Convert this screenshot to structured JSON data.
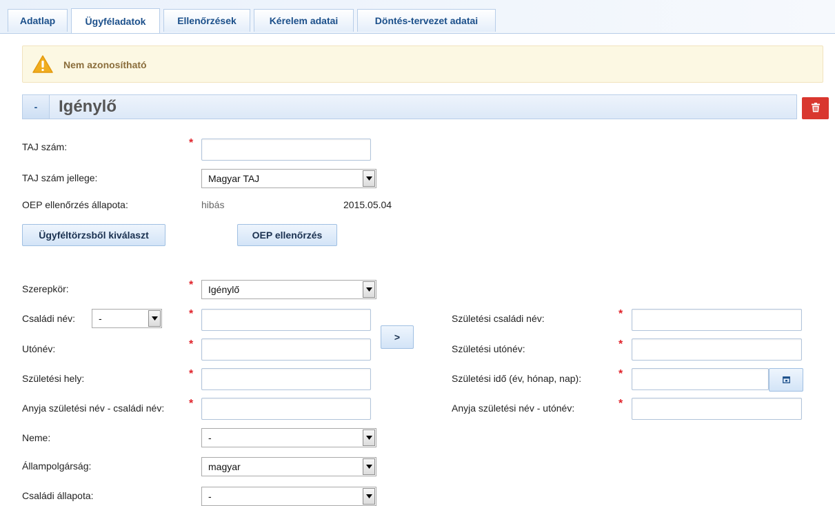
{
  "tabs": [
    {
      "label": "Adatlap"
    },
    {
      "label": "Ügyféladatok"
    },
    {
      "label": "Ellenőrzések"
    },
    {
      "label": "Kérelem adatai"
    },
    {
      "label": "Döntés-tervezet adatai"
    }
  ],
  "alert": {
    "text": "Nem azonosítható",
    "icon": "warning-icon",
    "color": "#8a6d3b"
  },
  "section": {
    "collapse_label": "-",
    "title": "Igénylő"
  },
  "form": {
    "taj_label": "TAJ szám:",
    "taj_value": "",
    "taj_type_label": "TAJ szám jellege:",
    "taj_type_value": "Magyar TAJ",
    "oep_status_label": "OEP ellenőrzés állapota:",
    "oep_status_value": "hibás",
    "oep_status_date": "2015.05.04",
    "select_client_button": "Ügyféltörzsből kiválaszt",
    "oep_check_button": "OEP ellenőrzés",
    "role_label": "Szerepkör:",
    "role_value": "Igénylő",
    "family_name_label": "Családi név:",
    "family_name_prefix": "-",
    "given_name_label": "Utónév:",
    "birth_place_label": "Születési hely:",
    "mother_family_label": "Anyja születési név - családi név:",
    "gender_label": "Neme:",
    "gender_value": "-",
    "citizenship_label": "Állampolgárság:",
    "citizenship_value": "magyar",
    "marital_label": "Családi állapota:",
    "marital_value": "-",
    "copy_button": ">",
    "birth_family_label": "Születési családi név:",
    "birth_given_label": "Születési utónév:",
    "birth_date_label": "Születési idő (év, hónap, nap):",
    "mother_given_label": "Anyja születési név - utónév:",
    "required_mark": "*"
  },
  "colors": {
    "required": "#e0222a",
    "delete": "#d9372f",
    "tab_text": "#1b4f8a"
  }
}
